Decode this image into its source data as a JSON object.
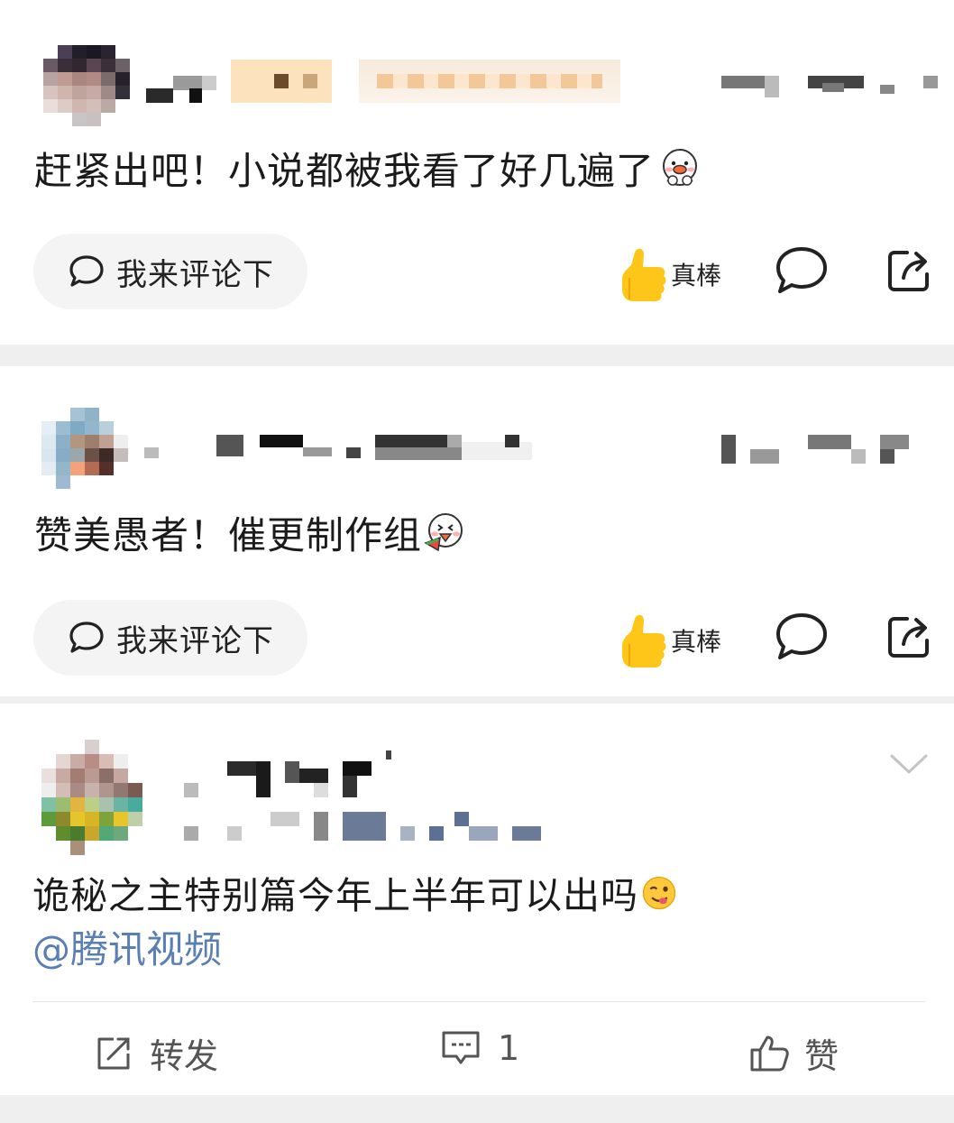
{
  "comments": [
    {
      "text": "赶紧出吧！小说都被我看了好几遍了",
      "emoji": "duck-shy-emoji",
      "reply_placeholder": "我来评论下",
      "like_label": "真棒"
    },
    {
      "text": "赞美愚者！催更制作组",
      "emoji": "duck-eating-emoji",
      "reply_placeholder": "我来评论下",
      "like_label": "真棒"
    }
  ],
  "post": {
    "text": "诡秘之主特别篇今年上半年可以出吗",
    "emoji": "yum-face-emoji",
    "mention": "@腾讯视频",
    "actions": {
      "repost_label": "转发",
      "comment_count": "1",
      "like_label": "赞"
    }
  },
  "colors": {
    "thumb_yellow": "#ffc61a",
    "mention_blue": "#5a7fb3",
    "separator": "#efefef",
    "pill_bg": "#f4f4f4"
  }
}
